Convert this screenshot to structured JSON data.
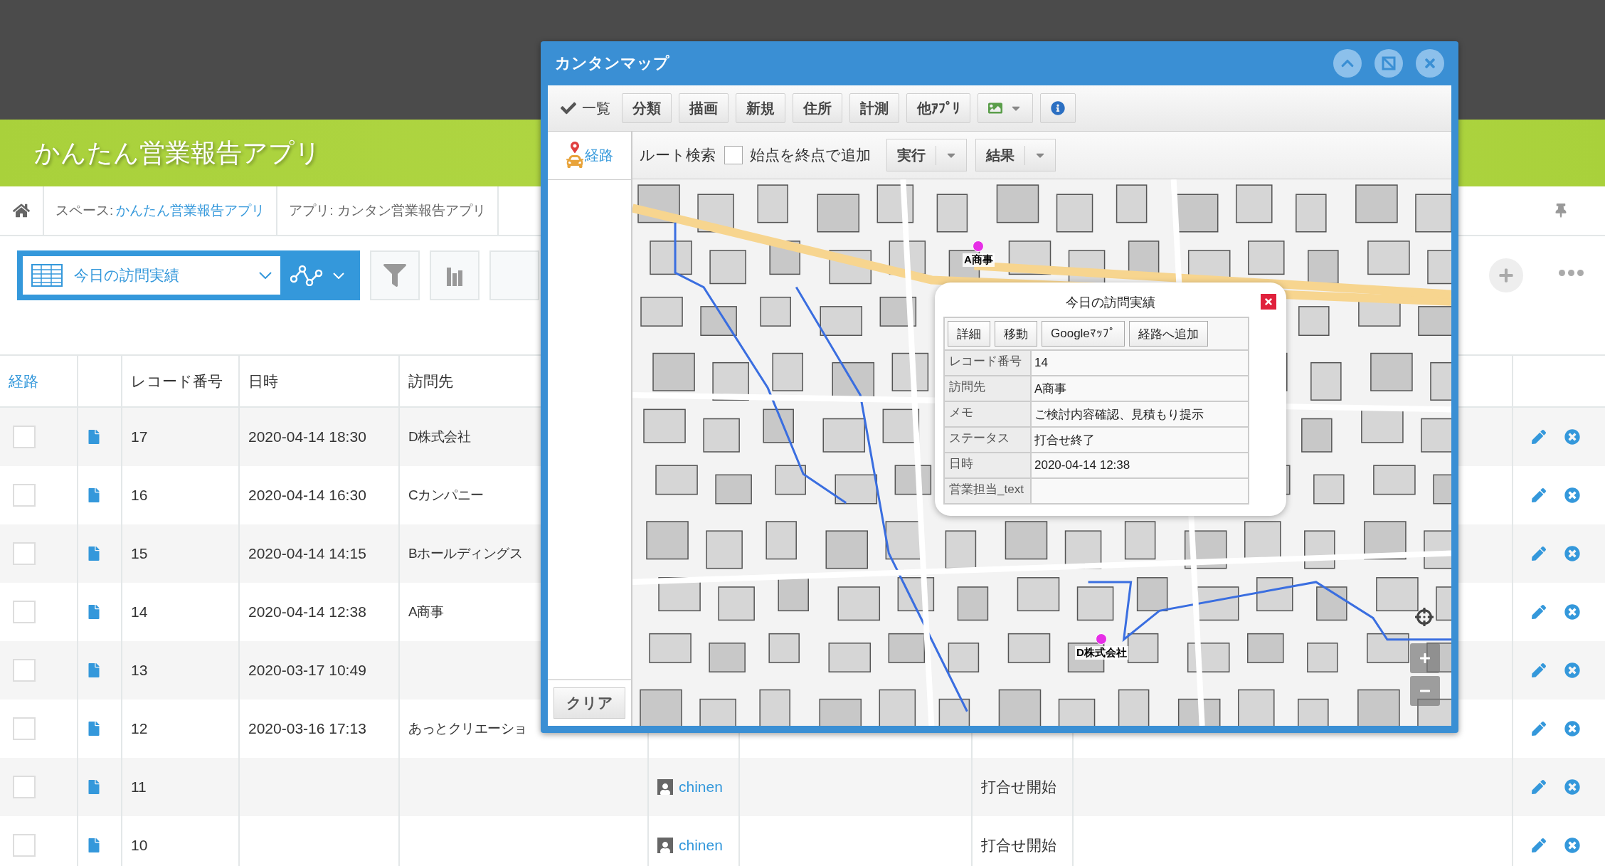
{
  "app_header": {
    "title": "かんたん営業報告アプリ"
  },
  "breadcrumb": [
    {
      "label": "スペース:",
      "link": "かんたん営業報告アプリ"
    },
    {
      "label": "アプリ: カンタン営業報告アプリ"
    }
  ],
  "view_selector": {
    "label": "今日の訪問実績"
  },
  "table": {
    "route_header": "経路",
    "columns": [
      "レコード番号",
      "日時",
      "訪問先"
    ],
    "rows": [
      {
        "checked": false,
        "record": "17",
        "datetime": "2020-04-14 18:30",
        "visit": "D株式会社"
      },
      {
        "checked": false,
        "record": "16",
        "datetime": "2020-04-14 16:30",
        "visit": "Cカンパニー"
      },
      {
        "checked": false,
        "record": "15",
        "datetime": "2020-04-14 14:15",
        "visit": "Bホールディングス"
      },
      {
        "checked": false,
        "record": "14",
        "datetime": "2020-04-14 12:38",
        "visit": "A商事"
      },
      {
        "checked": false,
        "record": "13",
        "datetime": "2020-03-17 10:49"
      },
      {
        "checked": false,
        "record": "12",
        "datetime": "2020-03-16 17:13",
        "visit": "あっとクリエーショ"
      },
      {
        "checked": false,
        "record": "11",
        "owner": "chinen",
        "status": "打合せ開始"
      },
      {
        "checked": false,
        "record": "10",
        "owner": "chinen",
        "status": "打合せ開始"
      }
    ]
  },
  "map_window": {
    "title": "カンタンマップ",
    "toolbar": {
      "list_toggle": {
        "label": "一覧",
        "checked": true
      },
      "buttons": [
        "分類",
        "描画",
        "新規",
        "住所",
        "計測",
        "他ｱﾌﾟﾘ"
      ]
    },
    "side_tab": {
      "label": "経路",
      "selected": true
    },
    "route_bar": {
      "label": "ルート検索",
      "option": {
        "label": "始点を終点で追加",
        "checked": false
      },
      "split_buttons": [
        "実行",
        "結果"
      ]
    },
    "clear_button": "クリア",
    "markers": [
      {
        "label": "A商事"
      },
      {
        "label": "D株式会社"
      }
    ],
    "popup": {
      "title": "今日の訪問実績",
      "buttons": [
        "詳細",
        "移動",
        "Googleﾏｯﾌﾟ",
        "経路へ追加"
      ],
      "fields": [
        {
          "label": "レコード番号",
          "value": "14"
        },
        {
          "label": "訪問先",
          "value": "A商事"
        },
        {
          "label": "メモ",
          "value": "ご検討内容確認、見積もり提示"
        },
        {
          "label": "ステータス",
          "value": "打合せ終了"
        },
        {
          "label": "日時",
          "value": "2020-04-14 12:38"
        },
        {
          "label": "営業担当_text"
        }
      ]
    }
  }
}
